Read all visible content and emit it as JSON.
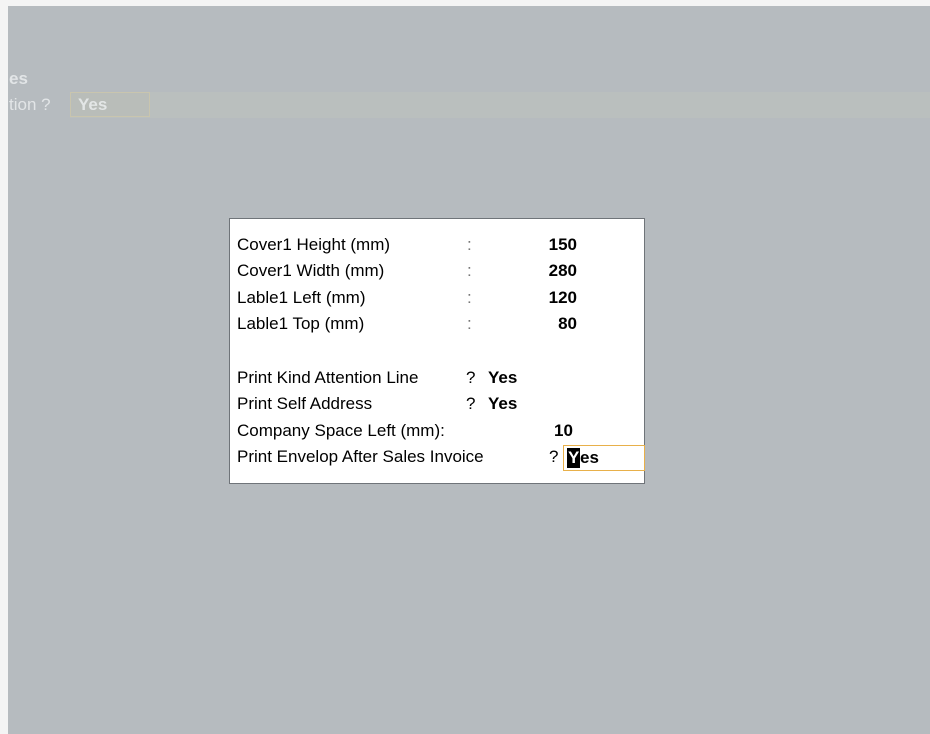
{
  "background": {
    "line1": "es",
    "line2_label": "tion ?",
    "line2_value": "Yes"
  },
  "dialog": {
    "fields": [
      {
        "label": "Cover1 Height (mm)",
        "sep": ":",
        "value": "150"
      },
      {
        "label": "Cover1 Width (mm)",
        "sep": ":",
        "value": "280"
      },
      {
        "label": "Lable1 Left (mm)",
        "sep": ":",
        "value": "120"
      },
      {
        "label": "Lable1 Top (mm)",
        "sep": ":",
        "value": "80"
      }
    ],
    "print_kind_attention": {
      "label": "Print Kind Attention Line",
      "q": "?",
      "value": "Yes"
    },
    "print_self_address": {
      "label": "Print Self Address",
      "q": "?",
      "value": "Yes"
    },
    "company_space_left": {
      "label": "Company Space Left (mm):",
      "value": "10"
    },
    "print_envelop": {
      "label": "Print Envelop After Sales Invoice",
      "q": "?",
      "value_cursor": "Y",
      "value_rest": "es"
    }
  }
}
